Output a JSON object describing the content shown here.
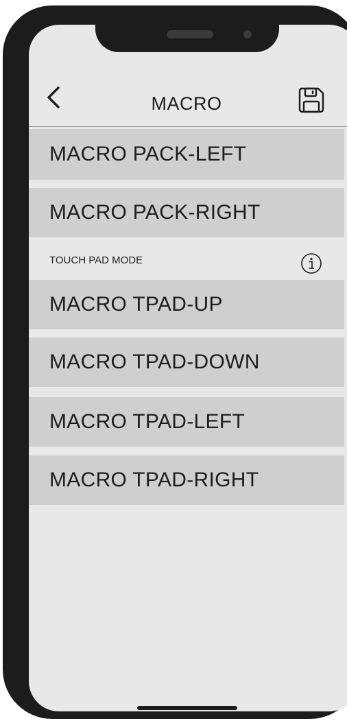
{
  "header": {
    "title": "MACRO",
    "back_icon": "chevron-left-icon",
    "save_icon": "floppy-disk-icon"
  },
  "macro_pack": {
    "items": [
      {
        "label": "MACRO PACK-LEFT"
      },
      {
        "label": "MACRO PACK-RIGHT"
      }
    ]
  },
  "touch_pad": {
    "section_label": "TOUCH PAD MODE",
    "info_icon": "info-icon",
    "items": [
      {
        "label": "MACRO TPAD-UP"
      },
      {
        "label": "MACRO TPAD-DOWN"
      },
      {
        "label": "MACRO TPAD-LEFT"
      },
      {
        "label": "MACRO TPAD-RIGHT"
      }
    ]
  },
  "colors": {
    "screen_bg": "#e8e8e8",
    "item_bg": "#cfcfcf",
    "frame": "#1c1c1c"
  }
}
